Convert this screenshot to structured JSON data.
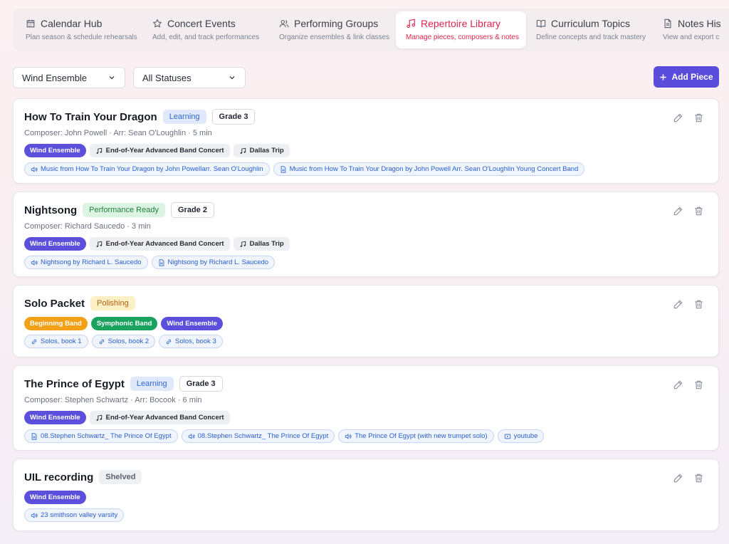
{
  "tabs": [
    {
      "label": "Calendar Hub",
      "desc": "Plan season & schedule rehearsals",
      "icon": "calendar-icon"
    },
    {
      "label": "Concert Events",
      "desc": "Add, edit, and track performances",
      "icon": "star-icon"
    },
    {
      "label": "Performing Groups",
      "desc": "Organize ensembles & link classes",
      "icon": "users-icon"
    },
    {
      "label": "Repertoire Library",
      "desc": "Manage pieces, composers & notes",
      "icon": "music-note-icon",
      "active": true
    },
    {
      "label": "Curriculum Topics",
      "desc": "Define concepts and track mastery",
      "icon": "book-icon"
    },
    {
      "label": "Notes His",
      "desc": "View and export c",
      "icon": "document-icon"
    }
  ],
  "filters": {
    "ensemble": "Wind Ensemble",
    "status": "All Statuses"
  },
  "add_button": "Add Piece",
  "colors": {
    "accent": "#5a4ddb",
    "active_tab": "#e0264f"
  },
  "pieces": [
    {
      "title": "How To Train Your Dragon",
      "status": "Learning",
      "grade": "Grade 3",
      "meta": "Composer: John Powell · Arr: Sean O'Loughlin · 5 min",
      "groups": [
        "Wind Ensemble"
      ],
      "events": [
        "End-of-Year Advanced Band Concert",
        "Dallas Trip"
      ],
      "links": [
        {
          "icon": "audio-icon",
          "text": "Music from How To Train Your Dragon by John Powellarr. Sean O'Loughlin"
        },
        {
          "icon": "document-icon",
          "text": "Music from How To Train Your Dragon by John Powell Arr. Sean O'Loughlin Young Concert Band"
        }
      ]
    },
    {
      "title": "Nightsong",
      "status": "Performance Ready",
      "grade": "Grade 2",
      "meta": "Composer: Richard Saucedo · 3 min",
      "groups": [
        "Wind Ensemble"
      ],
      "events": [
        "End-of-Year Advanced Band Concert",
        "Dallas Trip"
      ],
      "links": [
        {
          "icon": "audio-icon",
          "text": "Nightsong by Richard L. Saucedo"
        },
        {
          "icon": "document-icon",
          "text": "Nightsong by Richard L. Saucedo"
        }
      ]
    },
    {
      "title": "Solo Packet",
      "status": "Polishing",
      "grade": "",
      "meta": "",
      "groups": [
        "Beginning Band",
        "Symphonic Band",
        "Wind Ensemble"
      ],
      "events": [],
      "links": [
        {
          "icon": "link-icon",
          "text": "Solos, book 1"
        },
        {
          "icon": "link-icon",
          "text": "Solos, book 2"
        },
        {
          "icon": "link-icon",
          "text": "Solos, book 3"
        }
      ]
    },
    {
      "title": "The Prince of Egypt",
      "status": "Learning",
      "grade": "Grade 3",
      "meta": "Composer: Stephen Schwartz · Arr: Bocook · 6 min",
      "groups": [
        "Wind Ensemble"
      ],
      "events": [
        "End-of-Year Advanced Band Concert"
      ],
      "links": [
        {
          "icon": "document-icon",
          "text": "08.Stephen Schwartz_ The Prince Of Egypt"
        },
        {
          "icon": "audio-icon",
          "text": "08.Stephen Schwartz_ The Prince Of Egypt"
        },
        {
          "icon": "audio-icon",
          "text": "The Prince Of Egypt (with new trumpet solo)"
        },
        {
          "icon": "video-icon",
          "text": "youtube"
        }
      ]
    },
    {
      "title": "UIL recording",
      "status": "Shelved",
      "grade": "",
      "meta": "",
      "groups": [
        "Wind Ensemble"
      ],
      "events": [],
      "links": [
        {
          "icon": "audio-icon",
          "text": "23 smithson valley varsity"
        }
      ]
    }
  ]
}
